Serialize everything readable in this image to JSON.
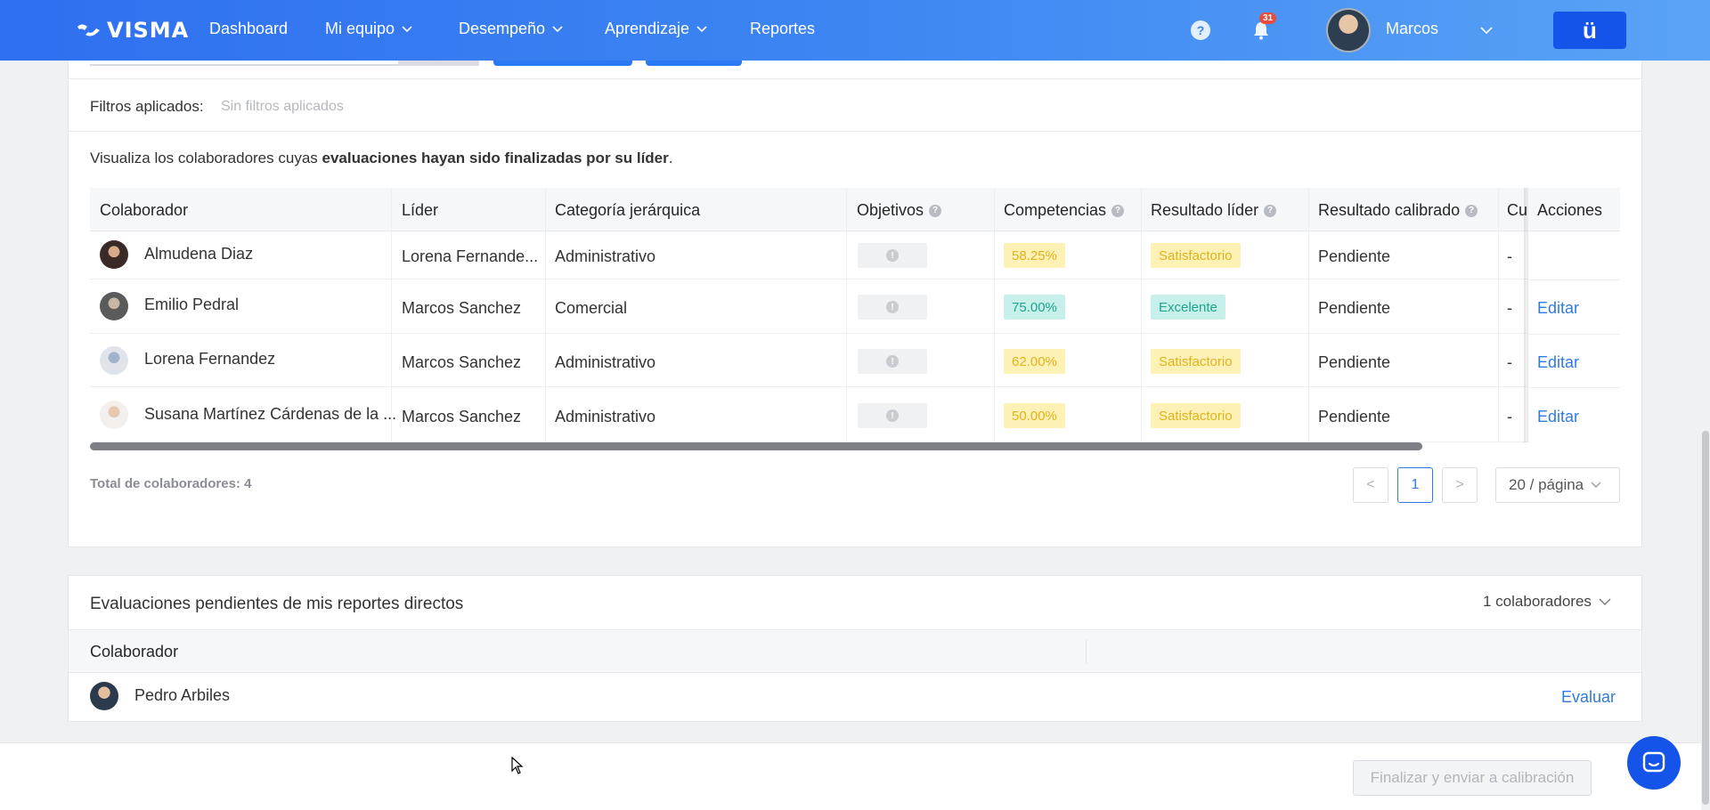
{
  "nav": {
    "brand": "VISMA",
    "items": [
      {
        "label": "Dashboard",
        "dropdown": false
      },
      {
        "label": "Mi equipo",
        "dropdown": true
      },
      {
        "label": "Desempeño",
        "dropdown": true
      },
      {
        "label": "Aprendizaje",
        "dropdown": true
      },
      {
        "label": "Reportes",
        "dropdown": false
      }
    ],
    "help": "?",
    "notifications": "31",
    "user": "Marcos",
    "app_button": "ü"
  },
  "filters": {
    "label": "Filtros aplicados:",
    "value": "Sin filtros aplicados"
  },
  "description": {
    "prefix": "Visualiza los colaboradores cuyas ",
    "bold": "evaluaciones hayan sido finalizadas por su líder",
    "suffix": "."
  },
  "table": {
    "headers": {
      "colaborador": "Colaborador",
      "lider": "Líder",
      "categoria": "Categoría jerárquica",
      "objetivos": "Objetivos",
      "competencias": "Competencias",
      "resultado_lider": "Resultado líder",
      "resultado_calibrado": "Resultado calibrado",
      "cu": "Cu",
      "acciones": "Acciones"
    },
    "rows": [
      {
        "colaborador": "Almudena Diaz",
        "lider": "Lorena Fernande...",
        "categoria": "Administrativo",
        "competencias": "58.25%",
        "resultado_lider": "Satisfactorio",
        "resultado_calibrado": "Pendiente",
        "cu": "-",
        "accion": ""
      },
      {
        "colaborador": "Emilio Pedral",
        "lider": "Marcos Sanchez",
        "categoria": "Comercial",
        "competencias": "75.00%",
        "resultado_lider": "Excelente",
        "resultado_calibrado": "Pendiente",
        "cu": "-",
        "accion": "Editar"
      },
      {
        "colaborador": "Lorena Fernandez",
        "lider": "Marcos Sanchez",
        "categoria": "Administrativo",
        "competencias": "62.00%",
        "resultado_lider": "Satisfactorio",
        "resultado_calibrado": "Pendiente",
        "cu": "-",
        "accion": "Editar"
      },
      {
        "colaborador": "Susana Martínez Cárdenas de la ...",
        "lider": "Marcos Sanchez",
        "categoria": "Administrativo",
        "competencias": "50.00%",
        "resultado_lider": "Satisfactorio",
        "resultado_calibrado": "Pendiente",
        "cu": "-",
        "accion": "Editar"
      }
    ],
    "total": "Total de colaboradores: 4"
  },
  "pagination": {
    "prev": "<",
    "page": "1",
    "next": ">",
    "page_size": "20 / página"
  },
  "pending": {
    "title": "Evaluaciones pendientes de mis reportes directos",
    "count": "1 colaboradores",
    "header": "Colaborador",
    "rows": [
      {
        "name": "Pedro Arbiles",
        "action": "Evaluar"
      }
    ]
  },
  "footer": {
    "finish_button": "Finalizar y enviar a calibración"
  },
  "colors": {
    "nav_start": "#2f6ff0",
    "nav_end": "#5aa3f6",
    "link": "#2f7ae5",
    "tag_yellow_bg": "#fdf1b5",
    "tag_yellow_fg": "#e0b21c",
    "tag_green_bg": "#c8f0ea",
    "tag_green_fg": "#1ea48f"
  }
}
